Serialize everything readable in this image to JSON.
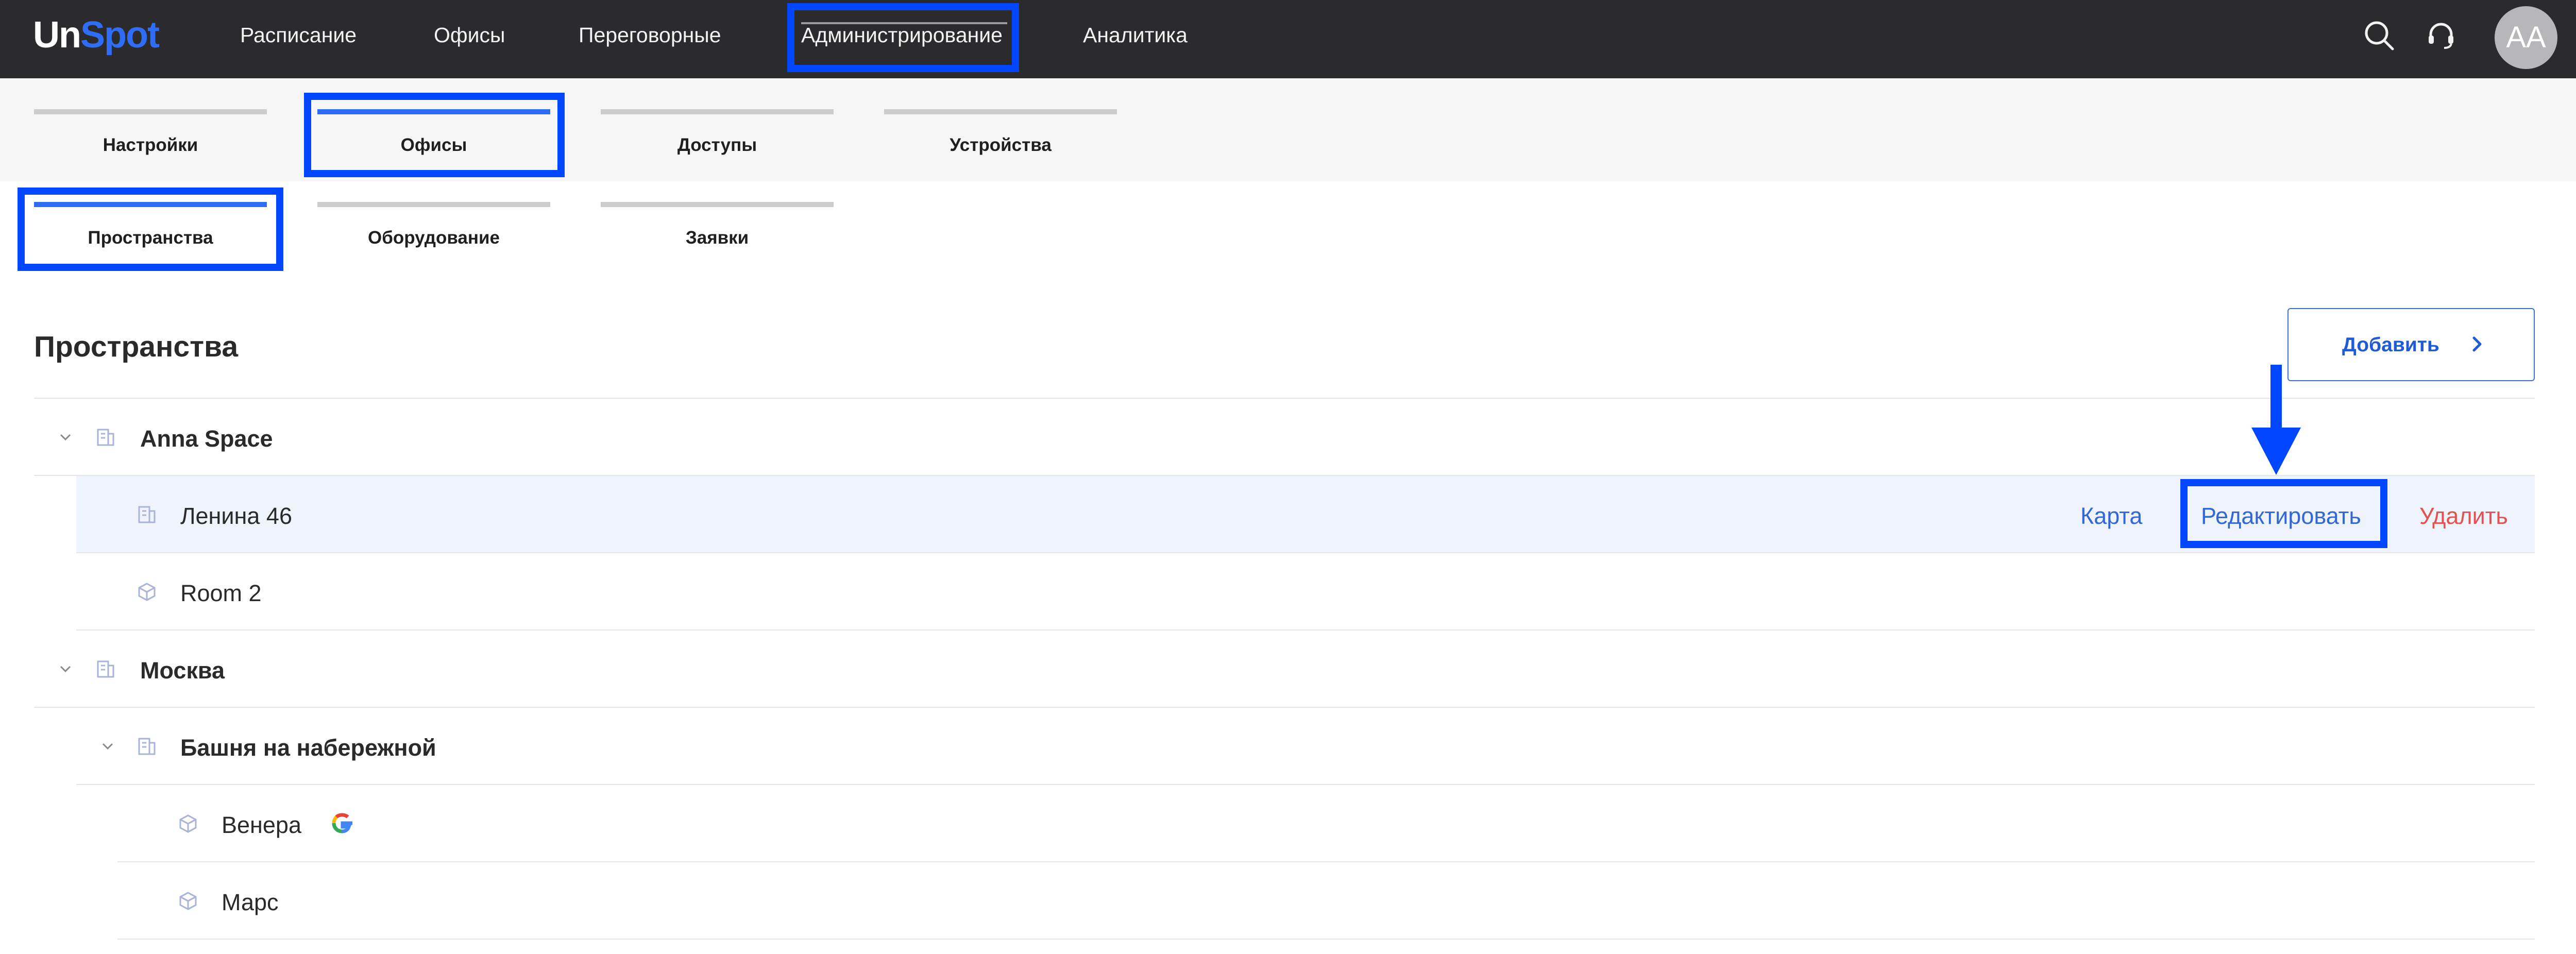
{
  "logo": {
    "part1": "Un",
    "part2": "Spot"
  },
  "nav": [
    {
      "label": "Расписание"
    },
    {
      "label": "Офисы"
    },
    {
      "label": "Переговорные"
    },
    {
      "label": "Администрирование"
    },
    {
      "label": "Аналитика"
    }
  ],
  "user": {
    "initials": "AA"
  },
  "admin_tabs": [
    {
      "label": "Настройки"
    },
    {
      "label": "Офисы"
    },
    {
      "label": "Доступы"
    },
    {
      "label": "Устройства"
    }
  ],
  "office_tabs": [
    {
      "label": "Пространства"
    },
    {
      "label": "Оборудование"
    },
    {
      "label": "Заявки"
    }
  ],
  "content": {
    "title": "Пространства",
    "add_button": "Добавить"
  },
  "tree": [
    {
      "name": "Anna Space"
    },
    {
      "name": "Ленина 46",
      "actions": {
        "map": "Карта",
        "edit": "Редактировать",
        "delete": "Удалить"
      }
    },
    {
      "name": "Room 2"
    },
    {
      "name": "Москва"
    },
    {
      "name": "Башня на набережной"
    },
    {
      "name": "Венера"
    },
    {
      "name": "Марс"
    }
  ],
  "colors": {
    "highlight": "#0046ff",
    "accent": "#2f6df6",
    "topbar": "#2b2b2d",
    "delete": "#e35252"
  }
}
